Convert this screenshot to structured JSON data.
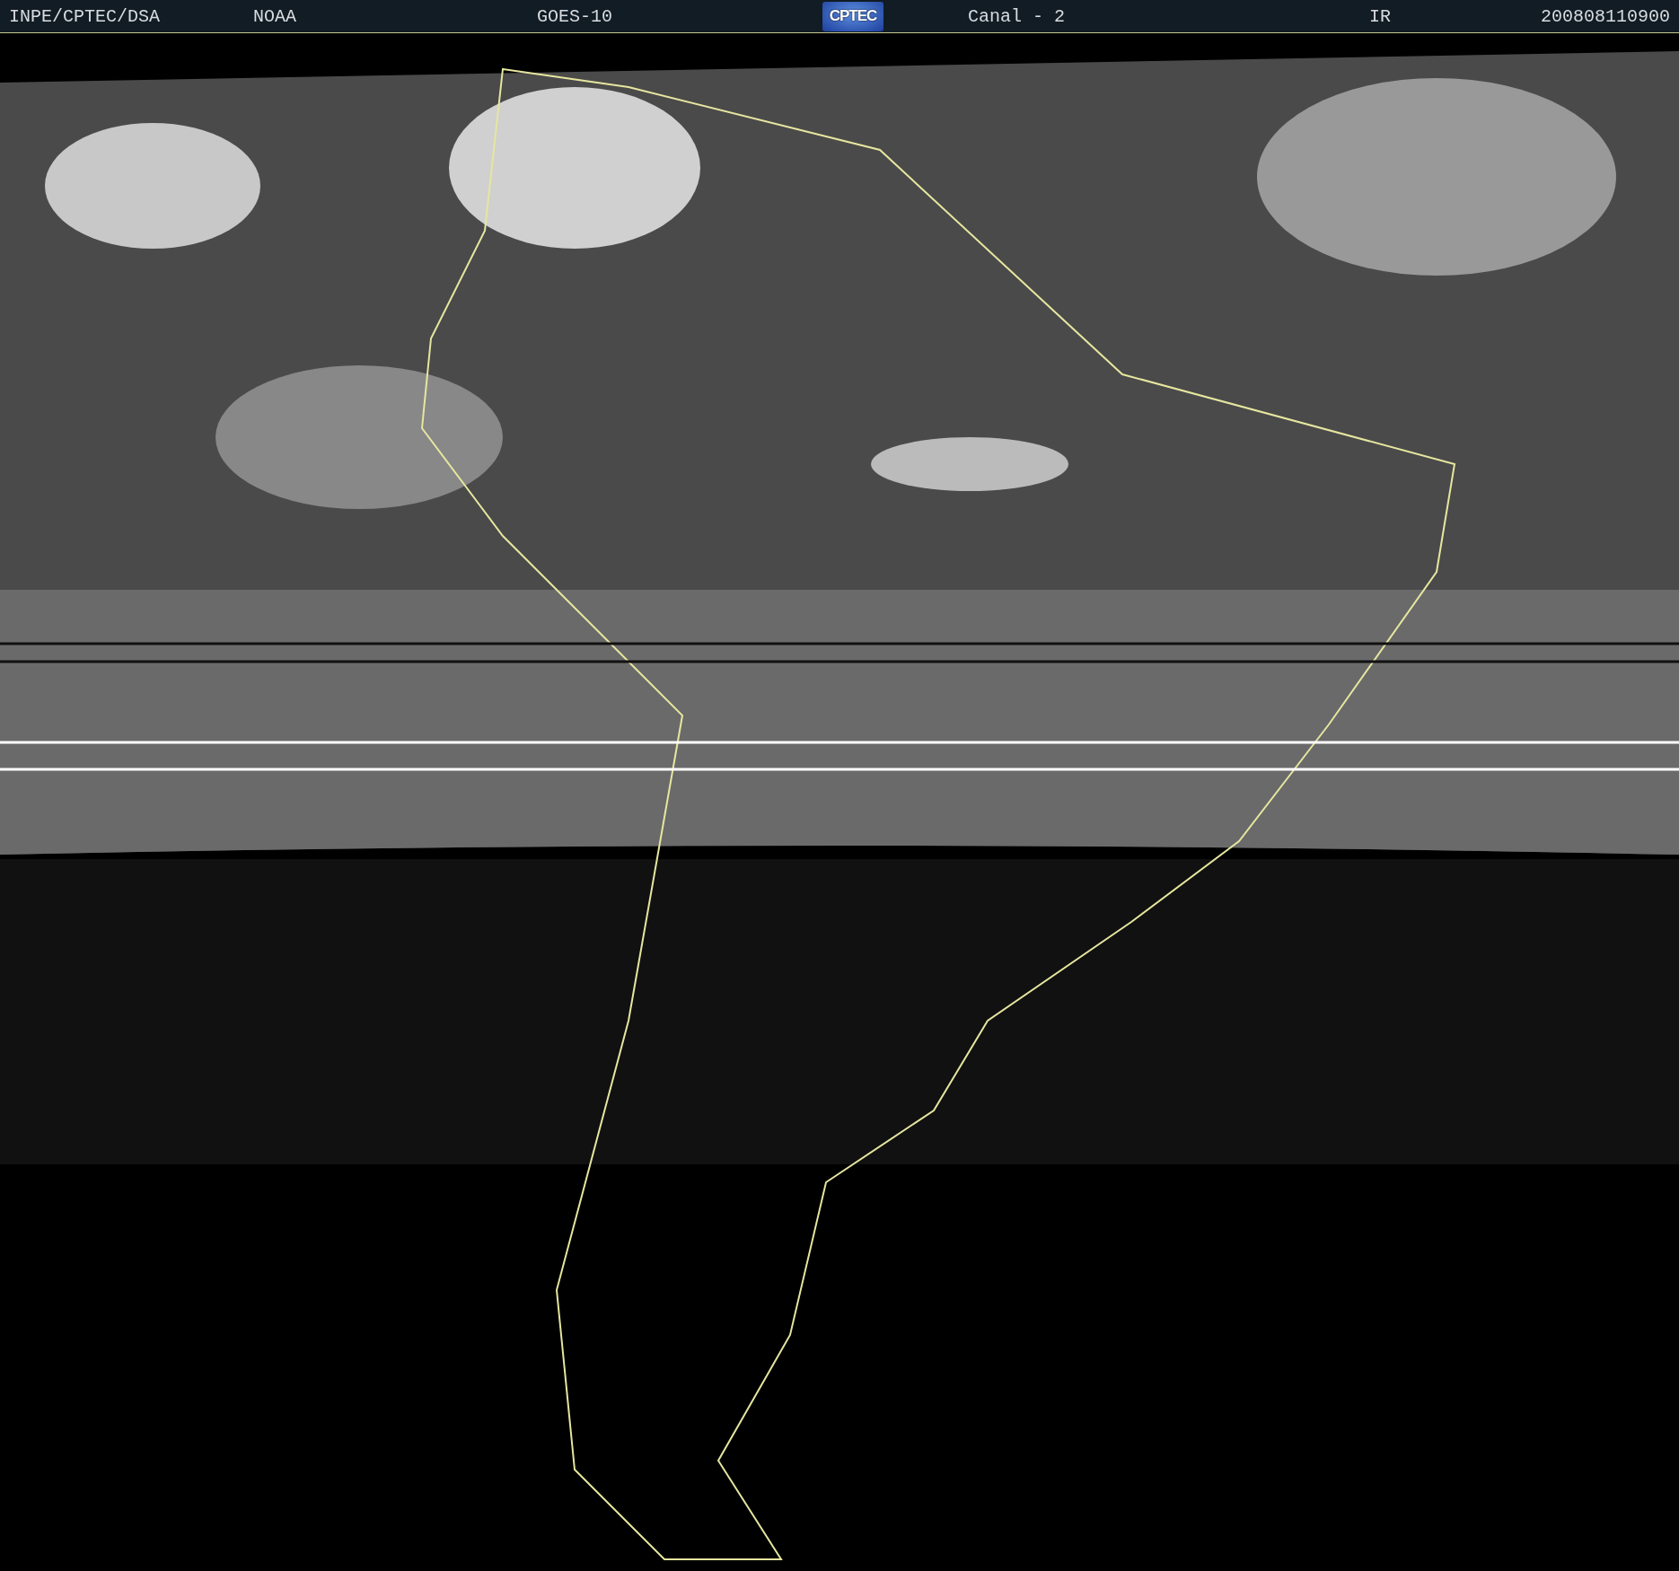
{
  "header": {
    "items": [
      {
        "kind": "text",
        "text": "INPE/CPTEC/DSA"
      },
      {
        "kind": "text",
        "text": "NOAA"
      },
      {
        "kind": "text",
        "text": "GOES-10"
      },
      {
        "kind": "logo",
        "text": "CPTEC"
      },
      {
        "kind": "text",
        "text": "Canal - 2"
      },
      {
        "kind": "text",
        "text": "IR"
      },
      {
        "kind": "text",
        "text": "200808110900"
      }
    ]
  }
}
